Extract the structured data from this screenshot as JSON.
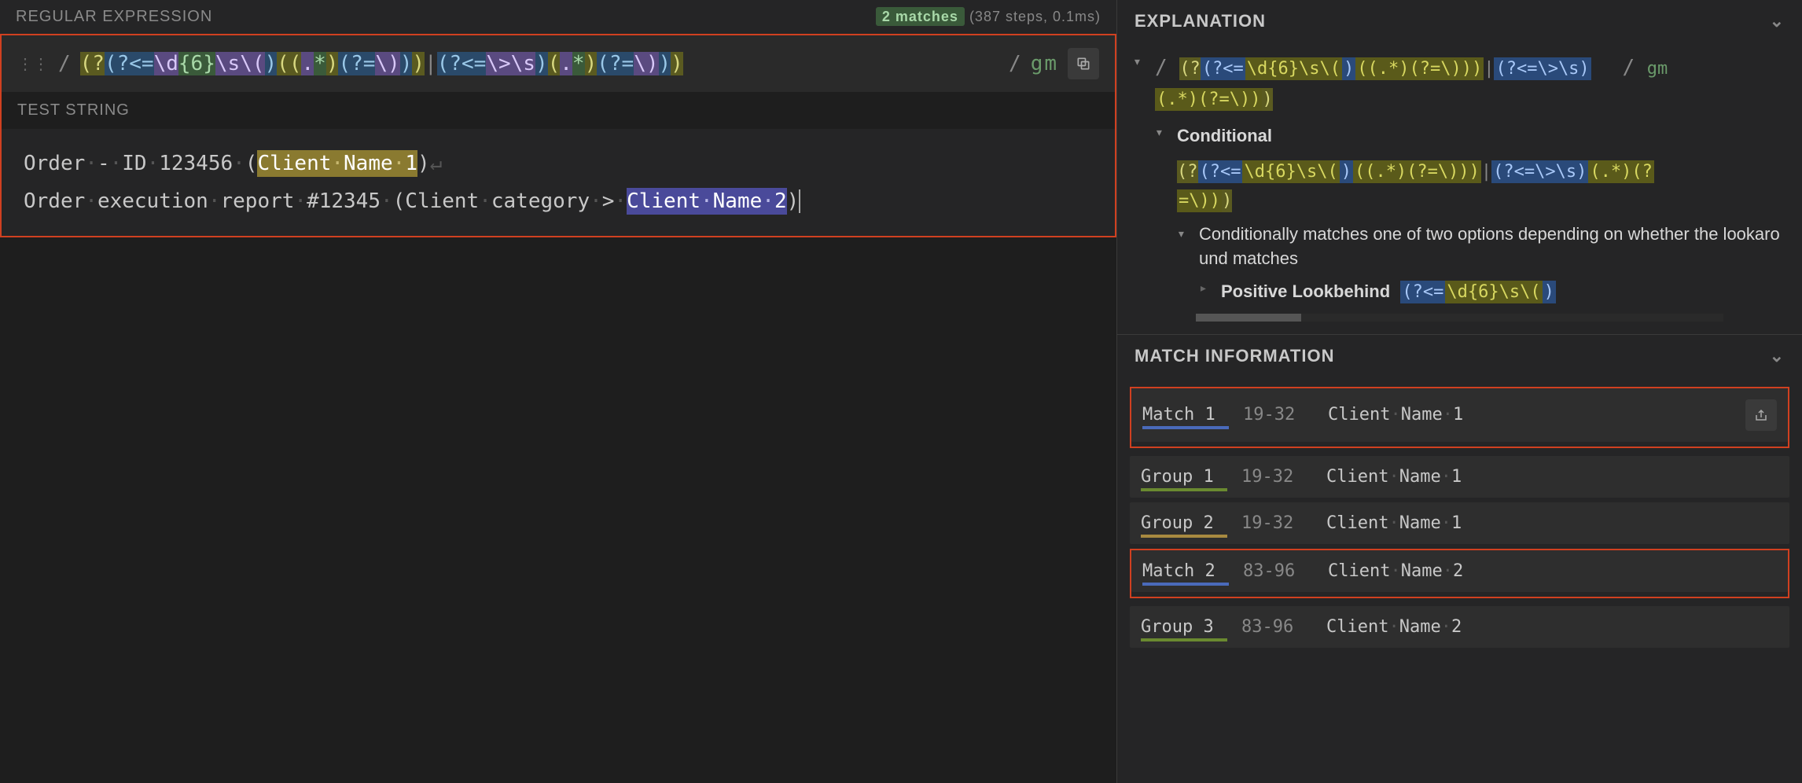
{
  "headers": {
    "regex": "REGULAR EXPRESSION",
    "test": "TEST STRING",
    "explanation": "EXPLANATION",
    "matchinfo": "MATCH INFORMATION"
  },
  "status": {
    "matches": "2 matches",
    "detail": "(387 steps, 0.1ms)"
  },
  "regex": {
    "delim_open": "/",
    "delim_close": "/",
    "flags": "gm",
    "pattern_display": "(?(?<=\\d{6}\\s\\()((.*)(?=\\)))|(?<=\\>\\s)(.*)(?=\\)))"
  },
  "test_string": {
    "line1_prefix": "Order - ID 123456 (",
    "line1_match": "Client Name 1",
    "line1_suffix": ")",
    "line2_prefix": "Order execution report #12345 (Client category > ",
    "line2_match": "Client Name 2",
    "line2_suffix": ")"
  },
  "explanation": {
    "conditional_label": "Conditional",
    "conditional_desc": "Conditionally matches one of two options depending on whether the lookaround matches",
    "lookbehind_label": "Positive Lookbehind",
    "lookbehind_pattern": "(?<=\\d{6}\\s\\()",
    "cond_pattern": "(?(?<=\\d{6}\\s\\()((.*)(?=\\)))|(?<=\\>\\s)(.*)(?=\\)))",
    "root_pattern": "(?(?<=\\d{6}\\s\\()((.*)(?=\\)))|(?<=\\>\\s)(.*)(?=\\)))"
  },
  "matches": [
    {
      "label": "Match 1",
      "range": "19-32",
      "text": "Client Name 1",
      "underline": "blue",
      "groups": [
        {
          "label": "Group 1",
          "range": "19-32",
          "text": "Client Name 1",
          "underline": "olive"
        },
        {
          "label": "Group 2",
          "range": "19-32",
          "text": "Client Name 1",
          "underline": "tan"
        }
      ]
    },
    {
      "label": "Match 2",
      "range": "83-96",
      "text": "Client Name 2",
      "underline": "blue",
      "groups": [
        {
          "label": "Group 3",
          "range": "83-96",
          "text": "Client Name 2",
          "underline": "olive"
        }
      ]
    }
  ]
}
